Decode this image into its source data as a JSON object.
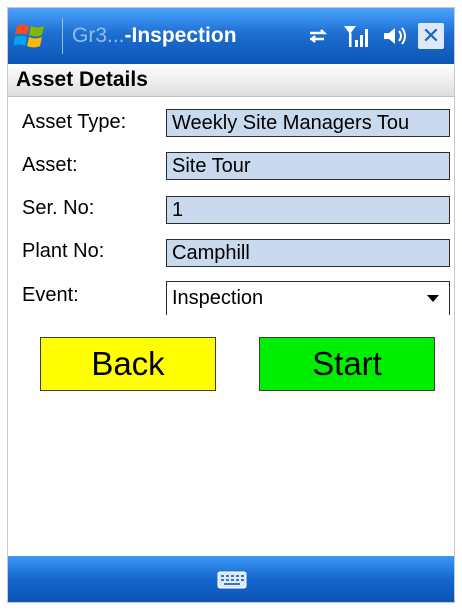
{
  "titlebar": {
    "app_name_faded": "Gr3...",
    "app_name": "-Inspection",
    "icons": [
      "windows-start-icon",
      "connectivity-icon",
      "signal-icon",
      "speaker-icon",
      "close-icon"
    ],
    "close_label": "✕"
  },
  "section": {
    "title": "Asset Details"
  },
  "form": {
    "asset_type": {
      "label": "Asset Type:",
      "value": "Weekly Site Managers Tou"
    },
    "asset": {
      "label": "Asset:",
      "value": "Site Tour"
    },
    "serial_no": {
      "label": "Ser. No:",
      "value": "1"
    },
    "plant_no": {
      "label": "Plant No:",
      "value": "Camphill"
    },
    "event": {
      "label": "Event:",
      "value": "Inspection"
    }
  },
  "buttons": {
    "back": "Back",
    "start": "Start"
  },
  "colors": {
    "titlebar": "#1e6fd0",
    "field_bg": "#c9d9ee",
    "back_button": "#ffff00",
    "start_button": "#00ee00"
  },
  "bottombar": {
    "icon": "keyboard-icon"
  }
}
